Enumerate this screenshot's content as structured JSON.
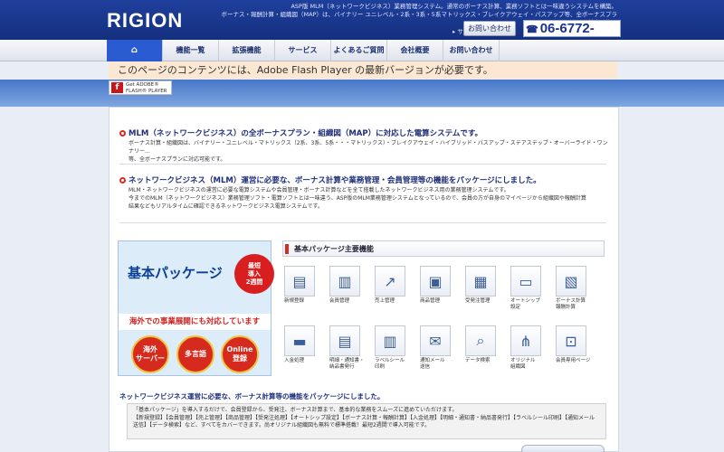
{
  "header": {
    "logo": "RIGION",
    "tagline_1": "ASP版 MLM（ネットワークビジネス）業務管理システム。通常のボーナス計算、業務ソフトとは一味違うシステムを構築。",
    "tagline_2": "ボーナス・報酬計算・組織図（MAP）は、バイナリー ユニレベル・2系・3系・5系マトリックス・ブレイクアウェイ・パスアップ等、全ボーナスプランに対応可能。",
    "sitemap": "▸ サイトマップ",
    "contact_button": "お問い合わせ",
    "phone": "06-6772-7701"
  },
  "nav": {
    "home_icon": "home-icon",
    "items": [
      "機能一覧",
      "拡張機能",
      "サービス",
      "よくあるご質問",
      "会社概要",
      "お問い合わせ"
    ]
  },
  "flash": {
    "message": "このページのコンテンツには、Adobe Flash Player の最新バージョンが必要です。",
    "badge_line1": "Get ADOBE®",
    "badge_line2": "FLASH® PLAYER"
  },
  "section1": {
    "title": "MLM（ネットワークビジネス）の全ボーナスプラン・組織図（MAP）に対応した電算システムです。",
    "body1": "ボーナス計算・組織図は、バイナリー・ユニレベル・マトリックス（2系、3系、5系・・・マトリックス）・ブレイクアウェイ・ハイブリッド・パスアップ・ステアステップ・オーバーライド・ワンナリー...",
    "body2": "等、全ボーナスプランに対応可能です。"
  },
  "section2": {
    "title": "ネットワークビジネス（MLM）運営に必要な、ボーナス計算や業務管理・会員管理等の機能をパッケージにしました。",
    "body1": "MLM・ネットワークビジネスの運営に必要な電算システムや会員管理・ボーナス計算などを全て搭載したネットワークビジネス用の業務管理システムです。",
    "body2": "今までのMLM（ネットワークビジネス）業務管理ソフト・電算ソフトとは一味違う、ASP版のMLM業務管理システムとなっているので、会員の方が自身のマイページから組織図や報酬計算",
    "body3": "結果などもリアルタイムに確認できるネットワークビジネス電算システムです。"
  },
  "package": {
    "title": "基本パッケージ",
    "burst": "最短\n導入\n2週間",
    "sub": "海外での事業展開にも対応しています",
    "medals": [
      "海外\nサーバー",
      "多言語",
      "Online\n登録"
    ]
  },
  "features": {
    "heading": "基本パッケージ主要機能",
    "items": [
      {
        "label": "新規登録",
        "icon": "register-icon"
      },
      {
        "label": "会員管理",
        "icon": "members-icon"
      },
      {
        "label": "売上管理",
        "icon": "sales-icon"
      },
      {
        "label": "商品管理",
        "icon": "products-icon"
      },
      {
        "label": "受発注管理",
        "icon": "orders-icon"
      },
      {
        "label": "オートシップ\n設定",
        "icon": "autoship-icon"
      },
      {
        "label": "ボーナス計算\n報酬計算",
        "icon": "bonus-icon"
      },
      {
        "label": "入金処理",
        "icon": "payment-icon"
      },
      {
        "label": "明細・通知書・\n納品書発行",
        "icon": "documents-icon"
      },
      {
        "label": "ラベルシール\n印刷",
        "icon": "label-icon"
      },
      {
        "label": "通知メール\n送信",
        "icon": "mail-icon"
      },
      {
        "label": "データ検索",
        "icon": "search-icon"
      },
      {
        "label": "オリジナル\n組織図",
        "icon": "orgchart-icon"
      },
      {
        "label": "会員専用ページ",
        "icon": "lock-icon"
      }
    ]
  },
  "bottom": {
    "title": "ネットワークビジネス運営に必要な、ボーナス計算等の機能をパッケージにしました。",
    "line1": "「基本パッケージ」を導入するだけで、会員登録から、受発注、ボーナス計算まで、基本的な業務をスムーズに進めていただけます。",
    "line2": "【新規登録】【会員管理】【売上管理】【商品管理】【受発注処理】【オートシップ設定】【ボーナス計算・報酬計算】【入金処理】【明細・通知書・納品書発行】【ラベルシール印刷】【通知メール",
    "line3": "送信】【データ検索】など、すべてをカバーできます。尚オリジナル組織図も無料で標準搭載！最短2週間で導入可能です。"
  }
}
